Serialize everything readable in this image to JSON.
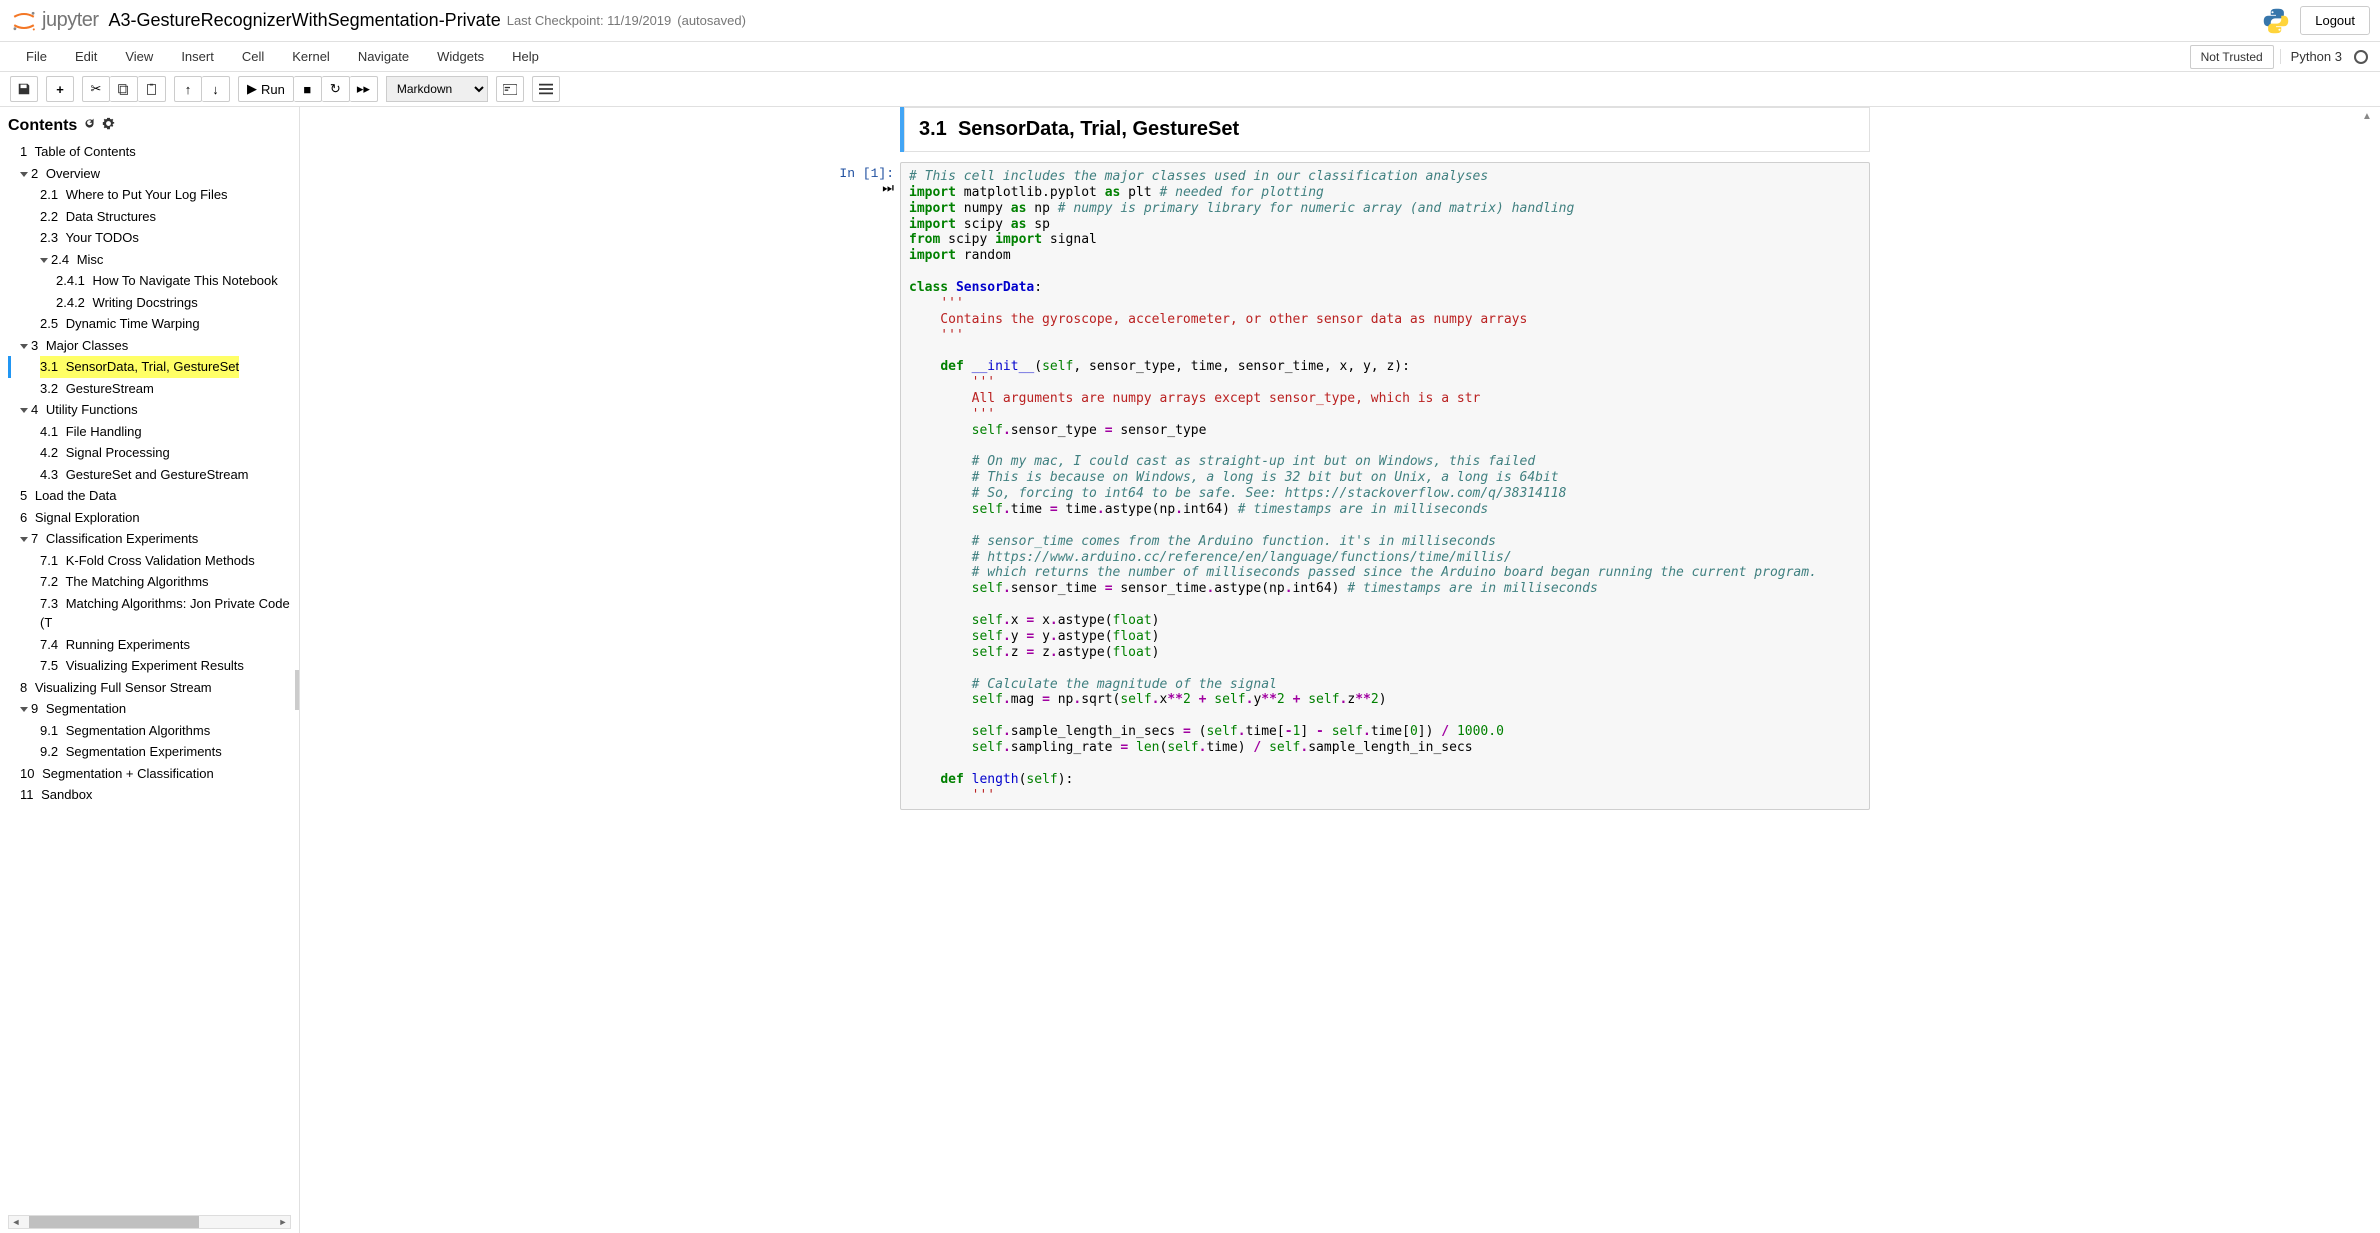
{
  "header": {
    "logo_text": "jupyter",
    "title": "A3-GestureRecognizerWithSegmentation-Private",
    "checkpoint": "Last Checkpoint: 11/19/2019",
    "autosaved": "(autosaved)",
    "logout": "Logout"
  },
  "menubar": {
    "items": [
      "File",
      "Edit",
      "View",
      "Insert",
      "Cell",
      "Kernel",
      "Navigate",
      "Widgets",
      "Help"
    ],
    "trust": "Not Trusted",
    "kernel": "Python 3"
  },
  "toolbar": {
    "run_label": "Run",
    "celltype": "Markdown"
  },
  "toc": {
    "header": "Contents",
    "items": [
      {
        "level": 1,
        "num": "1",
        "text": "Table of Contents",
        "caret": false
      },
      {
        "level": 1,
        "num": "2",
        "text": "Overview",
        "caret": true
      },
      {
        "level": 2,
        "num": "2.1",
        "text": "Where to Put Your Log Files"
      },
      {
        "level": 2,
        "num": "2.2",
        "text": "Data Structures"
      },
      {
        "level": 2,
        "num": "2.3",
        "text": "Your TODOs"
      },
      {
        "level": 2,
        "num": "2.4",
        "text": "Misc",
        "caret": true
      },
      {
        "level": 3,
        "num": "2.4.1",
        "text": "How To Navigate This Notebook"
      },
      {
        "level": 3,
        "num": "2.4.2",
        "text": "Writing Docstrings"
      },
      {
        "level": 2,
        "num": "2.5",
        "text": "Dynamic Time Warping"
      },
      {
        "level": 1,
        "num": "3",
        "text": "Major Classes",
        "caret": true
      },
      {
        "level": 2,
        "num": "3.1",
        "text": "SensorData, Trial, GestureSet",
        "active": true
      },
      {
        "level": 2,
        "num": "3.2",
        "text": "GestureStream"
      },
      {
        "level": 1,
        "num": "4",
        "text": "Utility Functions",
        "caret": true
      },
      {
        "level": 2,
        "num": "4.1",
        "text": "File Handling"
      },
      {
        "level": 2,
        "num": "4.2",
        "text": "Signal Processing"
      },
      {
        "level": 2,
        "num": "4.3",
        "text": "GestureSet and GestureStream"
      },
      {
        "level": 1,
        "num": "5",
        "text": "Load the Data"
      },
      {
        "level": 1,
        "num": "6",
        "text": "Signal Exploration"
      },
      {
        "level": 1,
        "num": "7",
        "text": "Classification Experiments",
        "caret": true
      },
      {
        "level": 2,
        "num": "7.1",
        "text": "K-Fold Cross Validation Methods"
      },
      {
        "level": 2,
        "num": "7.2",
        "text": "The Matching Algorithms"
      },
      {
        "level": 2,
        "num": "7.3",
        "text": "Matching Algorithms: Jon Private Code (T"
      },
      {
        "level": 2,
        "num": "7.4",
        "text": "Running Experiments"
      },
      {
        "level": 2,
        "num": "7.5",
        "text": "Visualizing Experiment Results"
      },
      {
        "level": 1,
        "num": "8",
        "text": "Visualizing Full Sensor Stream"
      },
      {
        "level": 1,
        "num": "9",
        "text": "Segmentation",
        "caret": true
      },
      {
        "level": 2,
        "num": "9.1",
        "text": "Segmentation Algorithms"
      },
      {
        "level": 2,
        "num": "9.2",
        "text": "Segmentation Experiments"
      },
      {
        "level": 1,
        "num": "10",
        "text": "Segmentation + Classification"
      },
      {
        "level": 1,
        "num": "11",
        "text": "Sandbox"
      }
    ]
  },
  "notebook": {
    "heading_num": "3.1",
    "heading_text": "SensorData, Trial, GestureSet",
    "prompt": "In [1]:"
  }
}
